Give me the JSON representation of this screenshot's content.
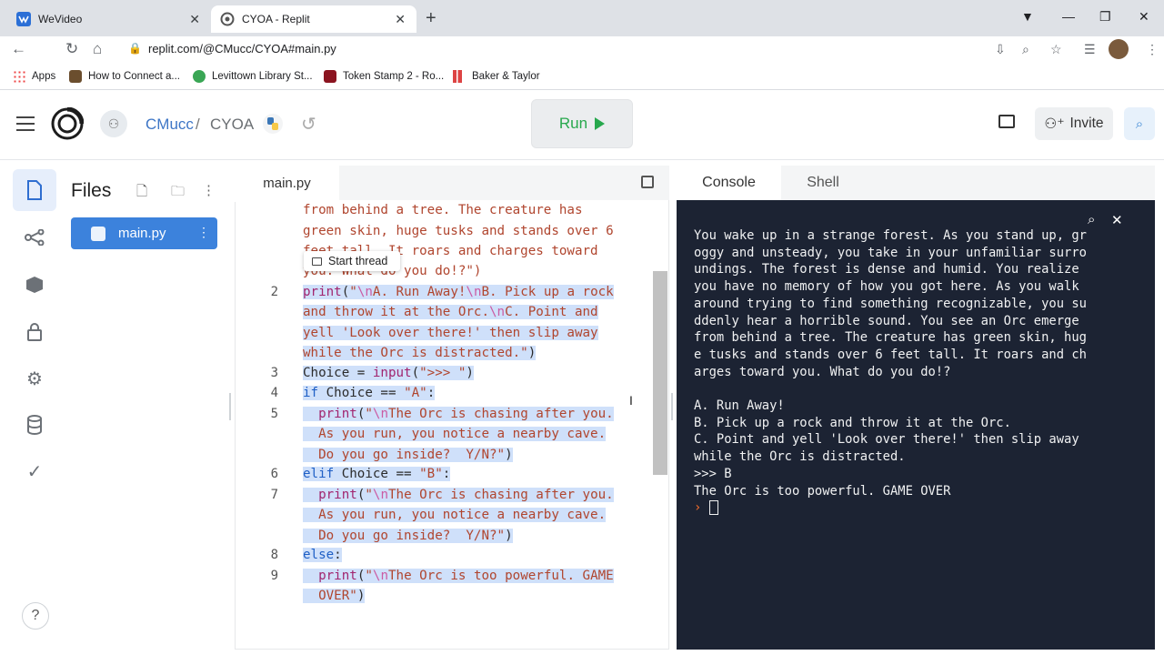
{
  "browser": {
    "tabs": [
      {
        "title": "WeVideo",
        "active": false
      },
      {
        "title": "CYOA - Replit",
        "active": true
      }
    ],
    "url": "replit.com/@CMucc/CYOA#main.py",
    "bookmarks": [
      "Apps",
      "How to Connect a...",
      "Levittown Library St...",
      "Token Stamp 2 - Ro...",
      "Baker & Taylor"
    ]
  },
  "header": {
    "owner": "CMucc",
    "separator": "/",
    "project": "CYOA",
    "run_label": "Run",
    "invite_label": "Invite",
    "run_color": "#27a84d",
    "accent": "#3c82dc"
  },
  "files": {
    "title": "Files",
    "items": [
      {
        "name": "main.py"
      }
    ]
  },
  "editor": {
    "tab": "main.py",
    "tooltip": "Start thread",
    "wrapped_top": [
      "from behind a tree. The creature has",
      "green skin, huge tusks and stands over 6",
      "feet tall. It roars and charges toward",
      "you. What do you do!?\")"
    ],
    "line_numbers": [
      "2",
      "3",
      "4",
      "5",
      "6",
      "7",
      "8",
      "9"
    ]
  },
  "console": {
    "tabs": [
      "Console",
      "Shell"
    ],
    "output": [
      "You wake up in a strange forest. As you stand up, gr",
      "oggy and unsteady, you take in your unfamiliar surro",
      "undings. The forest is dense and humid. You realize",
      "you have no memory of how you got here. As you walk",
      "around trying to find something recognizable, you su",
      "ddenly hear a horrible sound. You see an Orc emerge",
      "from behind a tree. The creature has green skin, hug",
      "e tusks and stands over 6 feet tall. It roars and ch",
      "arges toward you. What do you do!?",
      "",
      "A. Run Away!",
      "B. Pick up a rock and throw it at the Orc.",
      "C. Point and yell 'Look over there!' then slip away",
      "while the Orc is distracted.",
      ">>> B",
      "The Orc is too powerful. GAME OVER"
    ],
    "prompt": "›"
  }
}
